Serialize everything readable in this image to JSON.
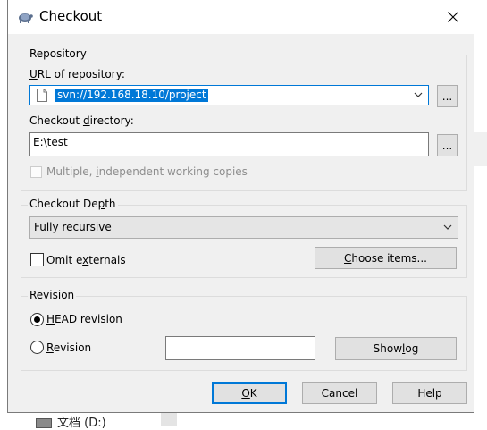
{
  "window": {
    "title": "Checkout",
    "icon": "tortoise-icon",
    "close_icon": "close-icon"
  },
  "repository": {
    "group_label": "Repository",
    "url_label_pre": "",
    "url_label_u": "U",
    "url_label_post": "RL of repository:",
    "url_value": "svn://192.168.18.10/project",
    "url_browse_label": "...",
    "dir_label_pre": "Checkout ",
    "dir_label_u": "d",
    "dir_label_post": "irectory:",
    "dir_value": "E:\\test",
    "dir_browse_label": "...",
    "multi_label_pre": "Multiple, ",
    "multi_label_u": "i",
    "multi_label_post": "ndependent working copies",
    "multi_checked": false,
    "multi_enabled": false
  },
  "depth": {
    "group_label_pre": "Checkout De",
    "group_label_u": "p",
    "group_label_post": "th",
    "selected": "Fully recursive",
    "omit_label_pre": "Omit e",
    "omit_label_u": "x",
    "omit_label_post": "ternals",
    "omit_checked": false,
    "choose_pre": "",
    "choose_u": "C",
    "choose_post": "hoose items..."
  },
  "revision": {
    "group_label": "Revision",
    "head_pre": "",
    "head_u": "H",
    "head_post": "EAD revision",
    "head_selected": true,
    "rev_pre": "",
    "rev_u": "R",
    "rev_post": "evision",
    "rev_selected": false,
    "rev_value": "",
    "showlog_pre": "Show ",
    "showlog_u": "l",
    "showlog_post": "og"
  },
  "buttons": {
    "ok_u": "O",
    "ok_post": "K",
    "cancel": "Cancel",
    "help": "Help"
  },
  "background": {
    "drive_label": "文档 (D:)"
  },
  "colors": {
    "accent": "#0078d7",
    "dialog_bg": "#f0f0f0"
  }
}
